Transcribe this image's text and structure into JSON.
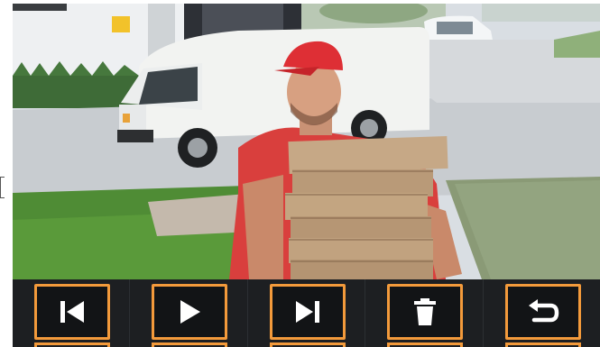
{
  "player": {
    "accent_color": "#f39a3b",
    "toolbar_color": "#1d1f22"
  },
  "controls": [
    {
      "id": "previous",
      "icon": "skip-previous-icon"
    },
    {
      "id": "play",
      "icon": "play-icon"
    },
    {
      "id": "next",
      "icon": "skip-next-icon"
    },
    {
      "id": "delete",
      "icon": "trash-icon"
    },
    {
      "id": "back",
      "icon": "return-arrow-icon"
    }
  ]
}
